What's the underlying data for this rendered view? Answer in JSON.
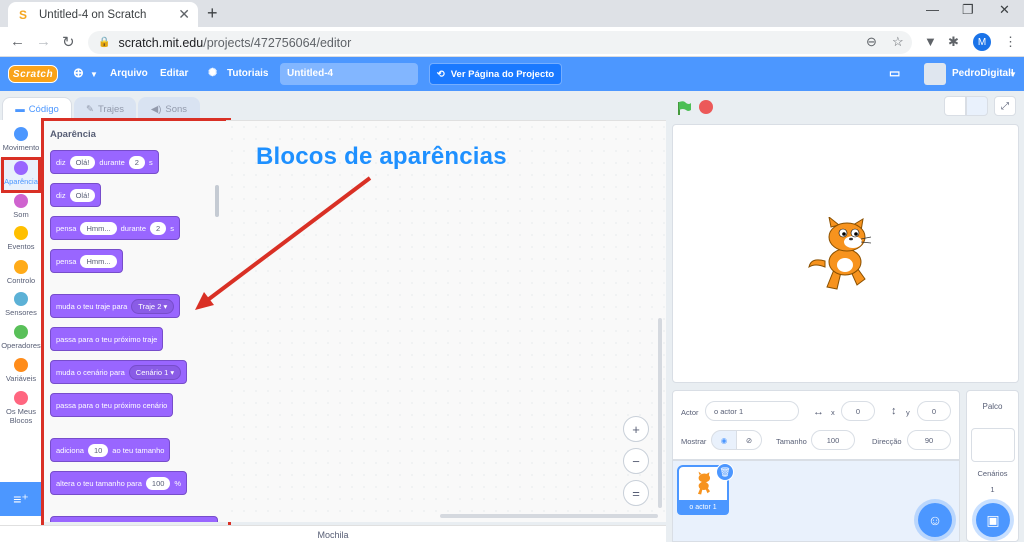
{
  "browser": {
    "tab_title": "Untitled-4 on Scratch",
    "tab_close": "✕",
    "new_tab": "+",
    "url_host": "scratch.mit.edu",
    "url_path": "/projects/472756064/editor",
    "profile_initial": "M",
    "window_controls": [
      "—",
      "❐",
      "✕"
    ]
  },
  "menubar": {
    "logo": "Scratch",
    "file": "Arquivo",
    "edit": "Editar",
    "tutorials": "Tutoriais",
    "project_title": "Untitled-4",
    "share": "Ver Página do Projecto",
    "username": "PedroDigitalI"
  },
  "editor_tabs": [
    {
      "label": "Código",
      "icon": "code-icon",
      "active": true
    },
    {
      "label": "Trajes",
      "icon": "brush-icon",
      "active": false
    },
    {
      "label": "Sons",
      "icon": "speaker-icon",
      "active": false
    }
  ],
  "categories": [
    {
      "label": "Movimento",
      "color": "#4c97ff",
      "selected": false
    },
    {
      "label": "Aparência",
      "color": "#9966ff",
      "selected": true
    },
    {
      "label": "Som",
      "color": "#cf63cf",
      "selected": false
    },
    {
      "label": "Eventos",
      "color": "#ffbf00",
      "selected": false
    },
    {
      "label": "Controlo",
      "color": "#ffab19",
      "selected": false
    },
    {
      "label": "Sensores",
      "color": "#5cb1d6",
      "selected": false
    },
    {
      "label": "Operadores",
      "color": "#59c059",
      "selected": false
    },
    {
      "label": "Variáveis",
      "color": "#ff8c1a",
      "selected": false
    },
    {
      "label": "Os Meus Blocos",
      "color": "#ff6680",
      "selected": false
    }
  ],
  "palette": {
    "title": "Aparência",
    "blocks": {
      "b1": {
        "w1": "diz",
        "in1": "Olá!",
        "w2": "durante",
        "in2": "2",
        "w3": "s"
      },
      "b2": {
        "w1": "diz",
        "in1": "Olá!"
      },
      "b3": {
        "w1": "pensa",
        "in1": "Hmm...",
        "w2": "durante",
        "in2": "2",
        "w3": "s"
      },
      "b4": {
        "w1": "pensa",
        "in1": "Hmm..."
      },
      "b5": {
        "w1": "muda o teu traje para",
        "dd": "Traje 2 ▾"
      },
      "b6": {
        "w1": "passa para o teu próximo traje"
      },
      "b7": {
        "w1": "muda o cenário para",
        "dd": "Cenário 1 ▾"
      },
      "b8": {
        "w1": "passa para o teu próximo cenário"
      },
      "b9": {
        "w1": "adiciona",
        "in1": "10",
        "w2": "ao teu tamanho"
      },
      "b10": {
        "w1": "altera o teu tamanho para",
        "in1": "100",
        "w2": "%"
      }
    }
  },
  "annotation": {
    "text": "Blocos de aparências",
    "color": "#1e90ff"
  },
  "workspace": {
    "zoom_in": "+",
    "zoom_out": "−",
    "reset": "="
  },
  "backpack": "Mochila",
  "sprite_info": {
    "actor_label": "Actor",
    "actor_name": "o actor 1",
    "x_label": "x",
    "x_value": "0",
    "y_label": "y",
    "y_value": "0",
    "show_label": "Mostrar",
    "size_label": "Tamanho",
    "size_value": "100",
    "direction_label": "Direcção",
    "direction_value": "90"
  },
  "sprite_tile": {
    "name": "o actor 1"
  },
  "stage_pane": {
    "title": "Palco",
    "backdrops_label": "Cenários",
    "backdrops_count": "1"
  },
  "colors": {
    "accent": "#4c97ff",
    "looks": "#9966ff",
    "highlight": "#d93025"
  }
}
